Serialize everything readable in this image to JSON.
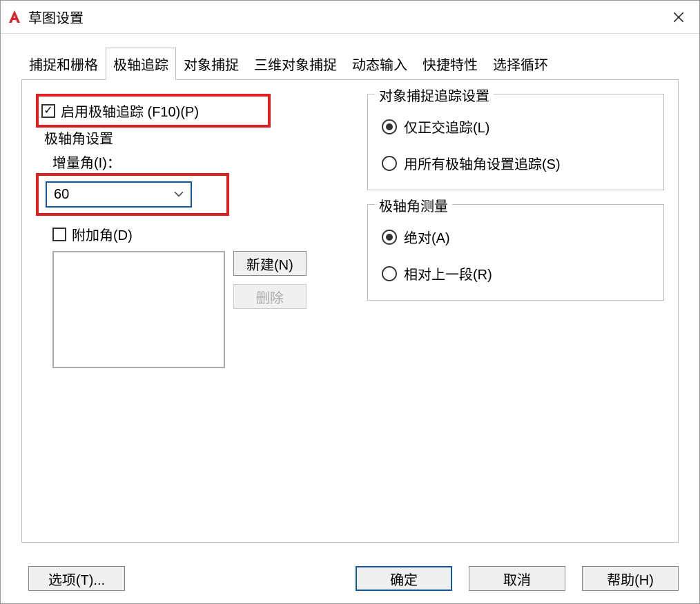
{
  "titlebar": {
    "title": "草图设置"
  },
  "tabs": {
    "t0": "捕捉和栅格",
    "t1": "极轴追踪",
    "t2": "对象捕捉",
    "t3": "三维对象捕捉",
    "t4": "动态输入",
    "t5": "快捷特性",
    "t6": "选择循环"
  },
  "polar": {
    "enable_label": "启用极轴追踪 (F10)(P)",
    "enable_checked": true,
    "group_label": "极轴角设置",
    "increment_label": "增量角(I)：",
    "increment_value": "60",
    "extra_angle_label": "附加角(D)",
    "extra_angle_checked": false,
    "new_btn": "新建(N)",
    "delete_btn": "删除"
  },
  "track": {
    "legend": "对象捕捉追踪设置",
    "ortho_label": "仅正交追踪(L)",
    "all_label": "用所有极轴角设置追踪(S)"
  },
  "measure": {
    "legend": "极轴角测量",
    "abs_label": "绝对(A)",
    "rel_label": "相对上一段(R)"
  },
  "bottom": {
    "options": "选项(T)...",
    "ok": "确定",
    "cancel": "取消",
    "help": "帮助(H)"
  }
}
